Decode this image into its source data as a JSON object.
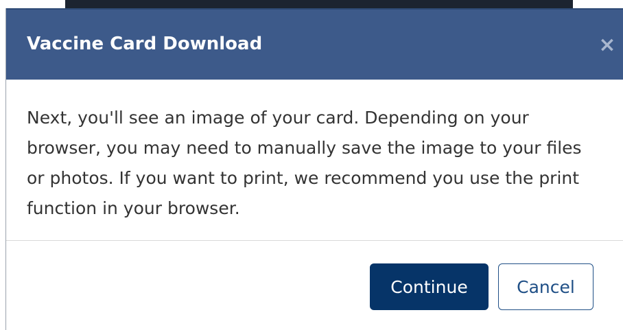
{
  "modal": {
    "title": "Vaccine Card Download",
    "close_icon": "×",
    "body_text": "Next, you'll see an image of your card. Depending on your browser, you may need to manually save the image to your files or photos. If you want to print, we recommend you use the print function in your browser.",
    "buttons": {
      "continue_label": "Continue",
      "cancel_label": "Cancel"
    }
  },
  "colors": {
    "header_bg": "#3d5a8a",
    "primary_button": "#063468",
    "secondary_button_border": "#1f4f86"
  }
}
